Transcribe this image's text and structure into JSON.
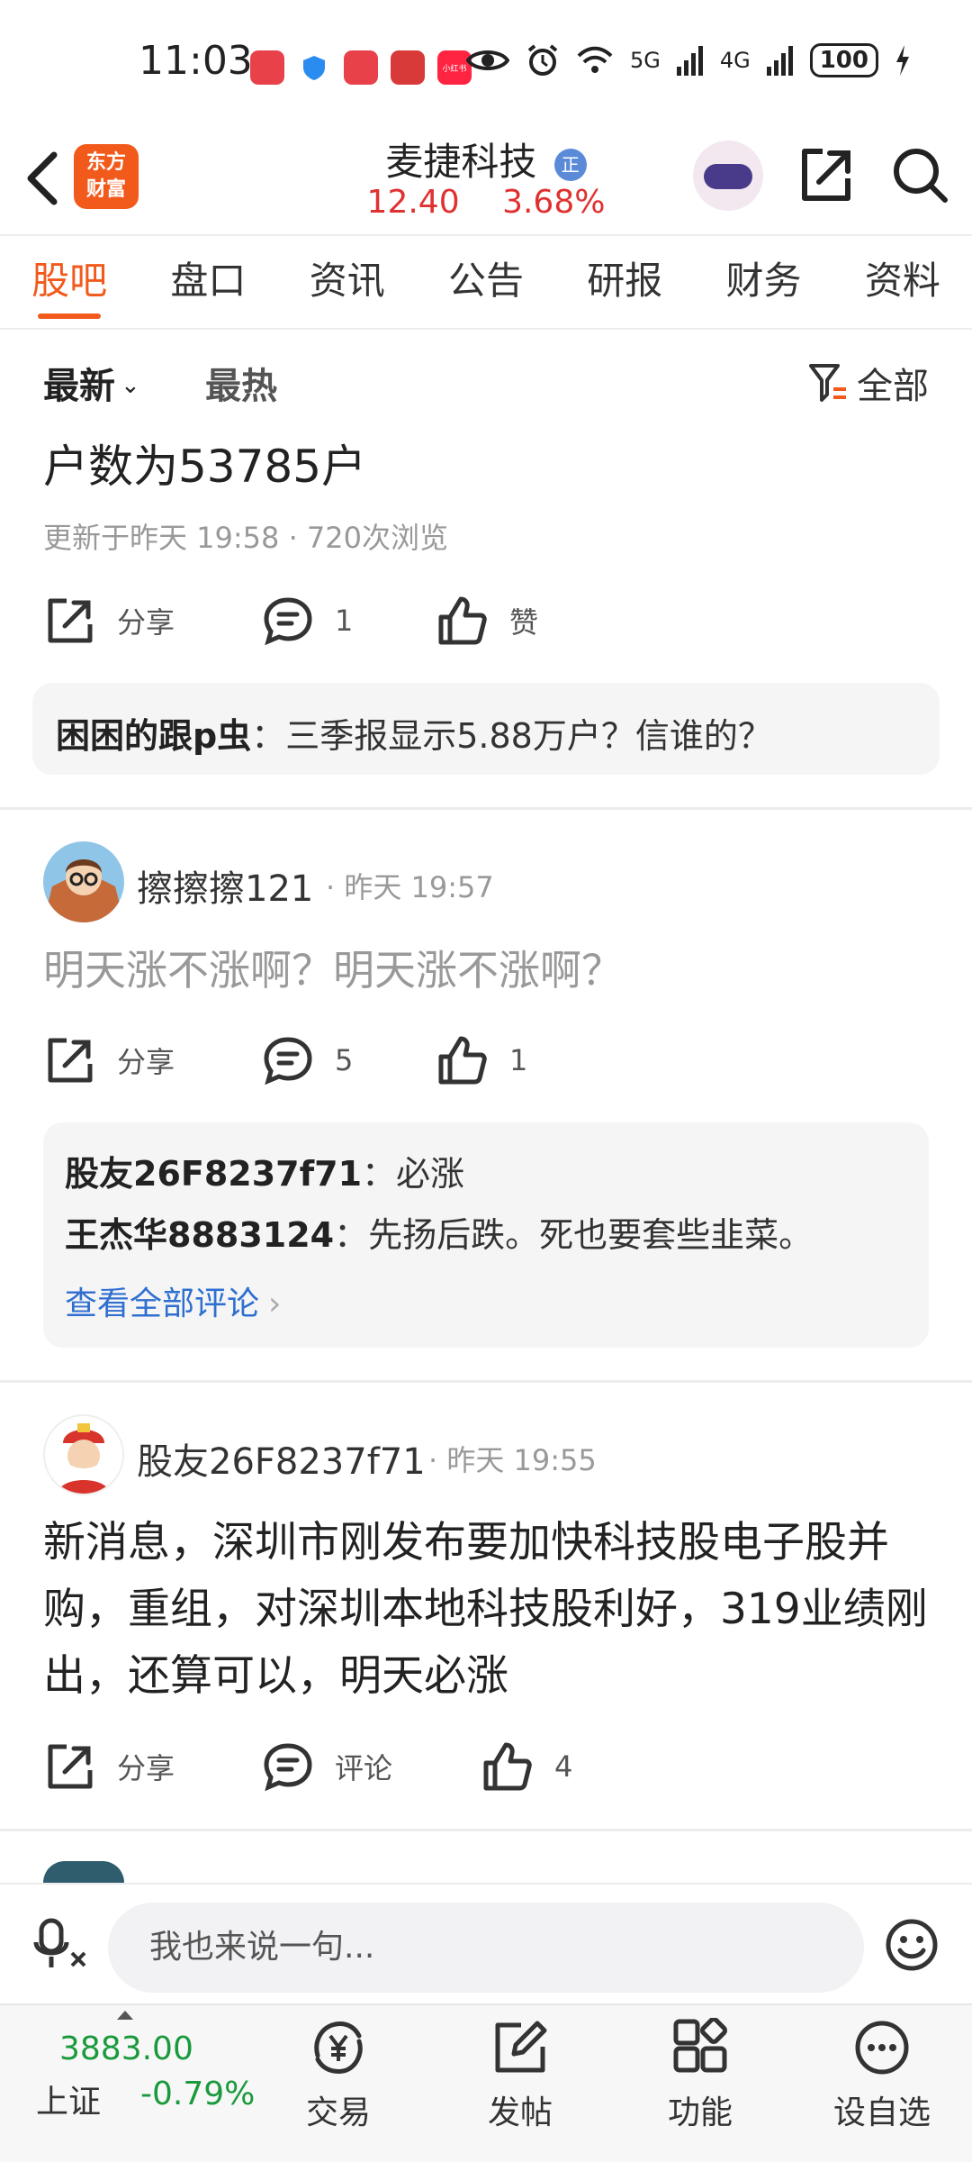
{
  "status_bar": {
    "time": "11:03",
    "app_icons": [
      {
        "name": "huawei-shop-icon",
        "label": "",
        "color": "#e8414a"
      },
      {
        "name": "shield-app-icon",
        "label": "",
        "color": "#2a8cf0"
      },
      {
        "name": "huawei-app-icon",
        "label": "",
        "color": "#e8414a"
      },
      {
        "name": "game-app-icon",
        "label": "",
        "color": "#d83a3a"
      },
      {
        "name": "xiaohongshu-icon",
        "label": "小红书",
        "color": "#ff2442"
      }
    ],
    "network_5g": "5G",
    "network_4g": "4G",
    "battery": "100"
  },
  "header": {
    "logo_line1": "东方",
    "logo_line2": "财富",
    "stock_name": "麦捷科技",
    "badge": "正",
    "price": "12.40",
    "change_pct": "3.68%"
  },
  "tabs": [
    "股吧",
    "盘口",
    "资讯",
    "公告",
    "研报",
    "财务",
    "资料"
  ],
  "sort": {
    "latest": "最新",
    "hot": "最热",
    "filter": "全部"
  },
  "posts": [
    {
      "text_tail": "户数为53785户",
      "meta": "更新于昨天 19:58 · 720次浏览",
      "share": "分享",
      "comments": "1",
      "likes": "赞",
      "top_comment": {
        "user": "困困的跟p虫",
        "text": "：三季报显示5.88万户？信谁的？"
      }
    },
    {
      "user": "擦擦擦121",
      "time": "· 昨天 19:57",
      "text": "明天涨不涨啊？明天涨不涨啊？",
      "share": "分享",
      "comments": "5",
      "likes": "1",
      "comments_preview": [
        {
          "user": "股友26F8237f71",
          "text": "：必涨"
        },
        {
          "user": "王杰华8883124",
          "text": "：先扬后跌。死也要套些韭菜。"
        }
      ],
      "view_all": "查看全部评论"
    },
    {
      "user": "股友26F8237f71",
      "time": "· 昨天 19:55",
      "text": "新消息，深圳市刚发布要加快科技股电子股并购，重组，对深圳本地科技股利好，319业绩刚出，还算可以，明天必涨",
      "share": "分享",
      "comments": "评论",
      "likes": "4"
    }
  ],
  "input": {
    "placeholder": "我也来说一句..."
  },
  "bottom_nav": {
    "index_value": "3883.00",
    "index_name": "上证",
    "index_change": "-0.79%",
    "items": [
      "交易",
      "发帖",
      "功能",
      "设自选"
    ]
  },
  "colors": {
    "accent": "#f25a1c",
    "up_red": "#e03131",
    "down_green": "#1a9a3c",
    "link_blue": "#2f6fd0"
  }
}
